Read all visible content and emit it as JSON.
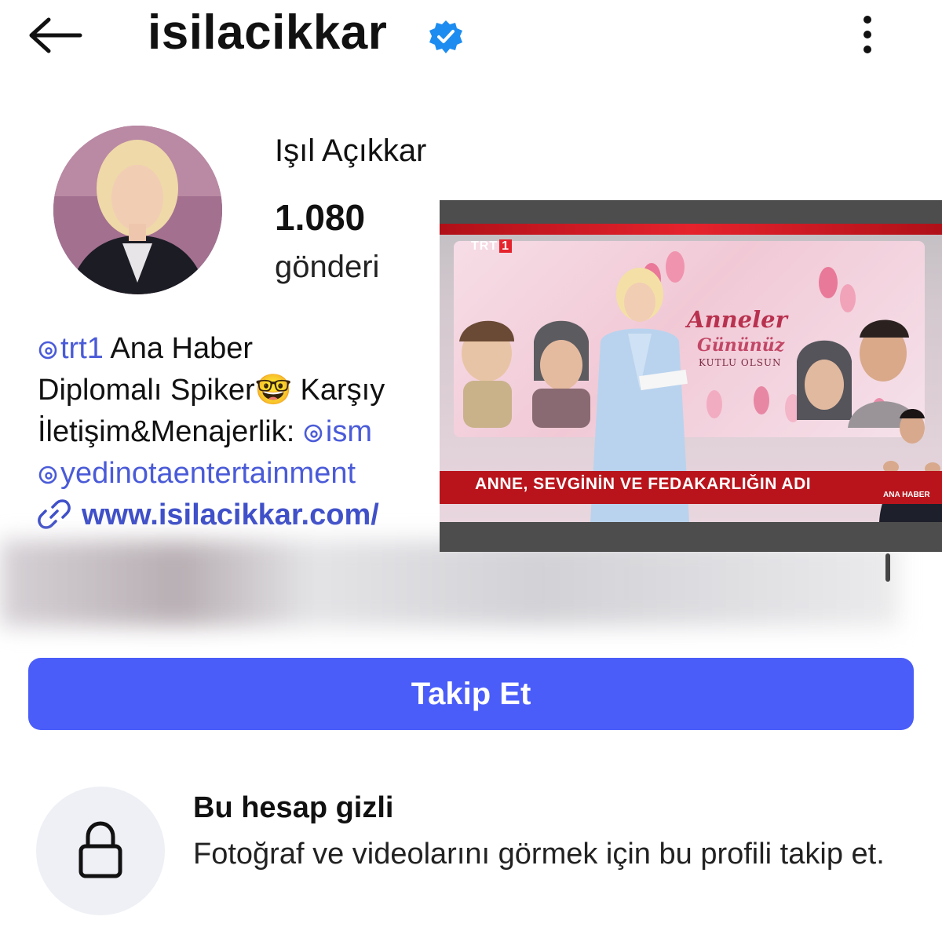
{
  "header": {
    "username": "isilacikkar",
    "back_icon": "arrow-left-icon",
    "verified_icon": "verified-badge-icon",
    "more_icon": "vertical-dots-icon"
  },
  "profile": {
    "display_name": "Işıl Açıkkar",
    "posts_count": "1.080",
    "posts_label": "gönderi"
  },
  "bio": {
    "line1_mention": "trt1",
    "line1_text": " Ana Haber",
    "line2_text": "Diplomalı Spiker🤓 Karşıy",
    "line3_text": "İletişim&Menajerlik: ",
    "line3_mention": "ism",
    "line4_mention": "yedinotaentertainment",
    "website": "www.isilacikkar.com/"
  },
  "actions": {
    "follow_label": "Takip Et"
  },
  "private_notice": {
    "title": "Bu hesap gizli",
    "description": "Fotoğraf ve videolarını görmek için bu profili takip et."
  },
  "tv_overlay": {
    "channel_logo": "TRT",
    "channel_number": "1",
    "banner_line1": "Anneler",
    "banner_line2": "Gününüz",
    "banner_line3": "KUTLU OLSUN",
    "ticker": "ANNE, SEVGİNİN VE FEDAKARLIĞIN ADI",
    "program_tag": "ANA HABER"
  },
  "colors": {
    "accent": "#4a5df9",
    "mention": "#4a5bd8",
    "tv_red": "#b9141c"
  }
}
